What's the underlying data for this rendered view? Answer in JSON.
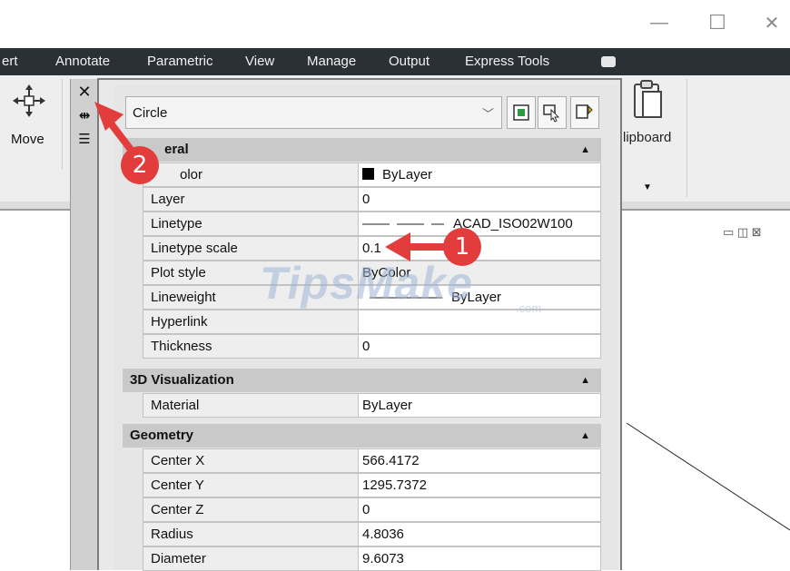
{
  "window": {
    "minimize": "—",
    "maximize": "☐",
    "close": "✕"
  },
  "ribbon_tabs": [
    "ert",
    "Annotate",
    "Parametric",
    "View",
    "Manage",
    "Output",
    "Express Tools"
  ],
  "ribbon": {
    "move_label": "Move",
    "clipboard_label": "lipboard"
  },
  "palette": {
    "object_type": "Circle",
    "sections": {
      "general": "eral",
      "visualization": "3D Visualization",
      "geometry": "Geometry"
    },
    "general_rows": [
      {
        "name": "olor",
        "value": "ByLayer"
      },
      {
        "name": "Layer",
        "value": "0"
      },
      {
        "name": "Linetype",
        "value": "ACAD_ISO02W100"
      },
      {
        "name": "Linetype scale",
        "value": "0.1"
      },
      {
        "name": "Plot style",
        "value": "ByColor"
      },
      {
        "name": "Lineweight",
        "value": "ByLayer"
      },
      {
        "name": "Hyperlink",
        "value": ""
      },
      {
        "name": "Thickness",
        "value": "0"
      }
    ],
    "visualization_rows": [
      {
        "name": "Material",
        "value": "ByLayer"
      }
    ],
    "geometry_rows": [
      {
        "name": "Center X",
        "value": "566.4172"
      },
      {
        "name": "Center Y",
        "value": "1295.7372"
      },
      {
        "name": "Center Z",
        "value": "0"
      },
      {
        "name": "Radius",
        "value": "4.8036"
      },
      {
        "name": "Diameter",
        "value": "9.6073"
      }
    ]
  },
  "annotations": {
    "badge_1": "1",
    "badge_2": "2"
  },
  "watermark": {
    "main": "TipsMake",
    "suffix": ".com"
  },
  "colors": {
    "tab_bar": "#2b2f36",
    "annotation_red": "#e23c3c",
    "section_header": "#c9c9c9"
  }
}
